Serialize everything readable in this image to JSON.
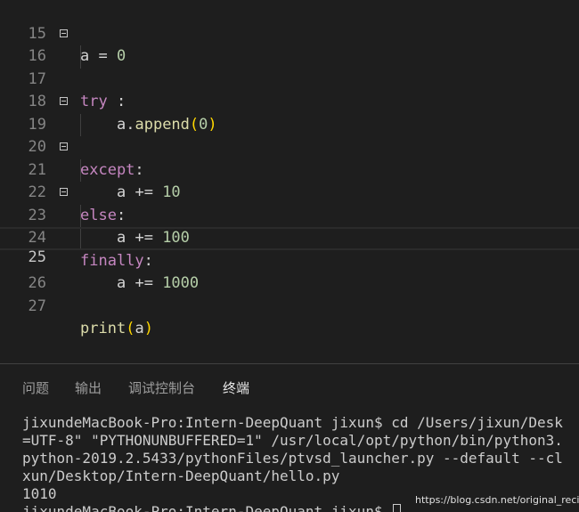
{
  "editor": {
    "lines": [
      {
        "num": "15",
        "tokens": [
          [
            "txt",
            "a = "
          ],
          [
            "num",
            "0"
          ]
        ]
      },
      {
        "num": "16",
        "tokens": [
          [
            "kw",
            "try"
          ],
          [
            "txt",
            " :"
          ]
        ]
      },
      {
        "num": "17",
        "tokens": [
          [
            "txt",
            "a."
          ],
          [
            "fn",
            "append"
          ],
          [
            "paren",
            "("
          ],
          [
            "num",
            "0"
          ],
          [
            "paren",
            ")"
          ]
        ]
      },
      {
        "num": "18",
        "tokens": []
      },
      {
        "num": "19",
        "tokens": [
          [
            "kw",
            "except"
          ],
          [
            "txt",
            ":"
          ]
        ]
      },
      {
        "num": "20",
        "tokens": [
          [
            "txt",
            "a += "
          ],
          [
            "num",
            "10"
          ]
        ]
      },
      {
        "num": "21",
        "tokens": [
          [
            "kw",
            "else"
          ],
          [
            "txt",
            ":"
          ]
        ]
      },
      {
        "num": "22",
        "tokens": [
          [
            "txt",
            "a += "
          ],
          [
            "num",
            "100"
          ]
        ]
      },
      {
        "num": "23",
        "tokens": [
          [
            "kw",
            "finally"
          ],
          [
            "txt",
            ":"
          ]
        ]
      },
      {
        "num": "24",
        "tokens": [
          [
            "txt",
            "a += "
          ],
          [
            "num",
            "1000"
          ]
        ]
      },
      {
        "num": "25",
        "tokens": []
      },
      {
        "num": "26",
        "tokens": []
      },
      {
        "num": "27",
        "tokens": [
          [
            "fn",
            "print"
          ],
          [
            "paren",
            "("
          ],
          [
            "txt",
            "a"
          ],
          [
            "paren",
            ")"
          ]
        ]
      }
    ]
  },
  "panel": {
    "tabs": {
      "problems": "问题",
      "output": "输出",
      "debug_console": "调试控制台",
      "terminal": "终端"
    },
    "terminal": {
      "line1": "jixundeMacBook-Pro:Intern-DeepQuant jixun$ cd /Users/jixun/Desk",
      "line2": "=UTF-8\" \"PYTHONUNBUFFERED=1\" /usr/local/opt/python/bin/python3.",
      "line3": "python-2019.2.5433/pythonFiles/ptvsd_launcher.py --default --cl",
      "line4": "xun/Desktop/Intern-DeepQuant/hello.py",
      "line5": "1010",
      "line6": "jixundeMacBook-Pro:Intern-DeepQuant jixun$ "
    }
  },
  "watermark": "https://blog.csdn.net/original_recipe"
}
